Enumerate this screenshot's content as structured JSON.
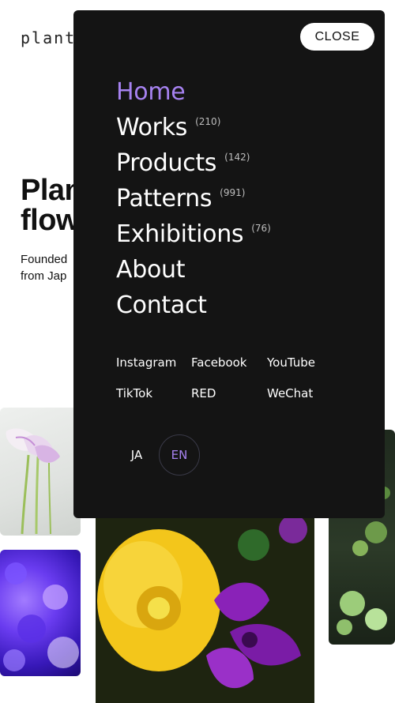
{
  "site": {
    "logo": "plant"
  },
  "hero": {
    "title_lines": [
      "Plan",
      "flow"
    ],
    "subtitle_lines": [
      "Founded",
      "from Jap"
    ]
  },
  "menu": {
    "close_label": "CLOSE",
    "items": [
      {
        "label": "Home",
        "count": "",
        "active": true
      },
      {
        "label": "Works",
        "count": "(210)"
      },
      {
        "label": "Products",
        "count": "(142)"
      },
      {
        "label": "Patterns",
        "count": "(991)"
      },
      {
        "label": "Exhibitions",
        "count": "(76)"
      },
      {
        "label": "About",
        "count": ""
      },
      {
        "label": "Contact",
        "count": ""
      }
    ],
    "social": [
      "Instagram",
      "Facebook",
      "YouTube",
      "TikTok",
      "RED",
      "WeChat"
    ],
    "languages": [
      {
        "label": "JA",
        "active": false
      },
      {
        "label": "EN",
        "active": true
      }
    ]
  },
  "colors": {
    "menu_bg": "#141414",
    "accent": "#a682f0",
    "text": "#ffffff",
    "count_text": "#bdbdbd"
  },
  "icons": []
}
